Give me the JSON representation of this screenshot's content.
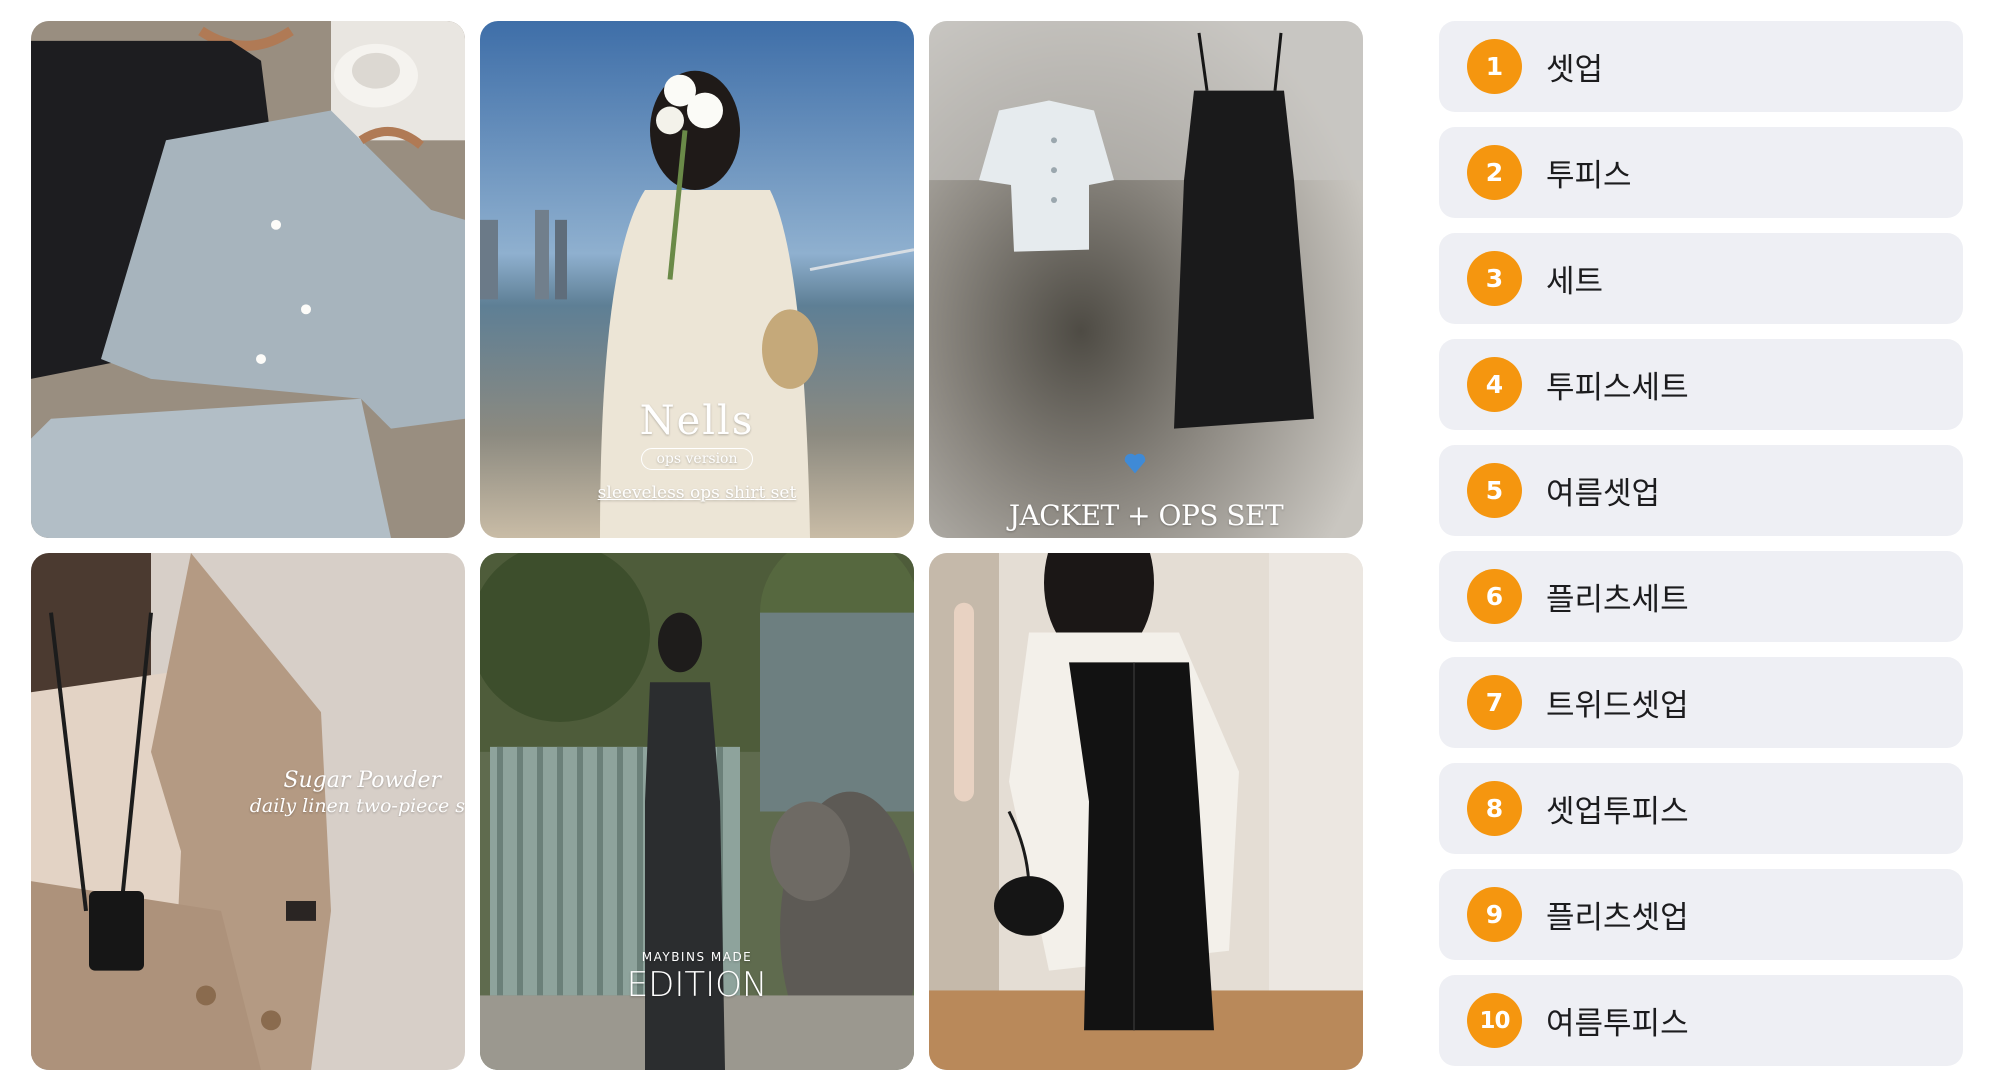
{
  "gallery": {
    "tiles": [
      {
        "caption_main": "",
        "caption_sub": "",
        "caption_extra": ""
      },
      {
        "caption_main": "Nells",
        "caption_sub": "ops version",
        "caption_extra": "sleeveless ops shirt set"
      },
      {
        "caption_main": "JACKET + OPS SET",
        "caption_sub": "",
        "caption_extra": ""
      },
      {
        "caption_main": "Sugar Powder",
        "caption_sub": "daily linen two-piece s",
        "caption_extra": ""
      },
      {
        "caption_main": "EDITION",
        "caption_sub": "MAYBINS MADE",
        "caption_extra": ""
      },
      {
        "caption_main": "",
        "caption_sub": "",
        "caption_extra": ""
      }
    ]
  },
  "ranking": {
    "accent_color": "#f5960f",
    "item_bg": "#eeeff4",
    "items": [
      {
        "rank": "1",
        "label": "셋업"
      },
      {
        "rank": "2",
        "label": "투피스"
      },
      {
        "rank": "3",
        "label": "세트"
      },
      {
        "rank": "4",
        "label": "투피스세트"
      },
      {
        "rank": "5",
        "label": "여름셋업"
      },
      {
        "rank": "6",
        "label": "플리츠세트"
      },
      {
        "rank": "7",
        "label": "트위드셋업"
      },
      {
        "rank": "8",
        "label": "셋업투피스"
      },
      {
        "rank": "9",
        "label": "플리츠셋업"
      },
      {
        "rank": "10",
        "label": "여름투피스"
      }
    ]
  }
}
